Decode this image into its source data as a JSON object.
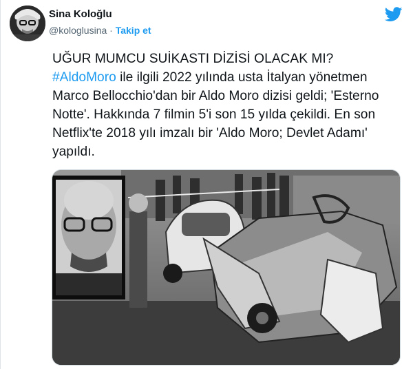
{
  "author": {
    "display_name": "Sina Koloğlu",
    "handle": "@kologlusina",
    "separator": "·",
    "follow_label": "Takip et"
  },
  "tweet": {
    "line1": "UĞUR MUMCU SUİKASTI DİZİSİ OLACAK MI?",
    "hashtag": "#AldoMoro",
    "body": " ile ilgili 2022 yılında usta İtalyan yönetmen Marco Bellocchio'dan bir Aldo Moro dizisi geldi; 'Esterno Notte'. Hakkında 7 filmin 5'i son 15 yılda çekildi. En son Netflix'te 2018 yılı imzalı bir 'Aldo Moro; Devlet Adamı' yapıldı."
  },
  "icons": {
    "avatar": "profile-photo",
    "brand": "twitter-bird-icon",
    "media": "black-and-white-car-wreck-photo"
  },
  "colors": {
    "accent": "#1d9bf0",
    "text": "#0f1419",
    "secondary": "#536471",
    "border": "#cfd9de"
  }
}
